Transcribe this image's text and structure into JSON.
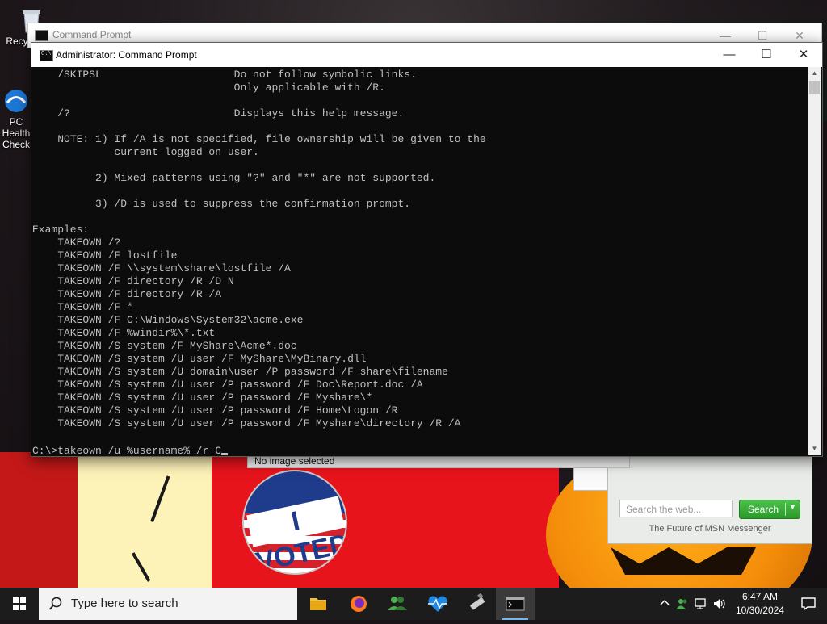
{
  "desktop": {
    "icons": [
      {
        "label": "Recycle Bin"
      },
      {
        "label": "PC Health Check"
      }
    ],
    "pin_text": "I VOTED",
    "msn_widget": {
      "search_placeholder": "Search the web...",
      "search_button": "Search",
      "tagline": "The Future of MSN Messenger"
    },
    "no_image_text": "No image selected"
  },
  "window_back": {
    "title": "Command Prompt",
    "controls": {
      "minimize": "—",
      "maximize": "☐",
      "close": "✕"
    }
  },
  "window": {
    "title": "Administrator: Command Prompt",
    "controls": {
      "minimize": "—",
      "maximize": "☐",
      "close": "✕"
    },
    "console_lines": [
      "    /SKIPSL                     Do not follow symbolic links.",
      "                                Only applicable with /R.",
      "",
      "    /?                          Displays this help message.",
      "",
      "    NOTE: 1) If /A is not specified, file ownership will be given to the",
      "             current logged on user.",
      "",
      "          2) Mixed patterns using \"?\" and \"*\" are not supported.",
      "",
      "          3) /D is used to suppress the confirmation prompt.",
      "",
      "Examples:",
      "    TAKEOWN /?",
      "    TAKEOWN /F lostfile",
      "    TAKEOWN /F \\\\system\\share\\lostfile /A",
      "    TAKEOWN /F directory /R /D N",
      "    TAKEOWN /F directory /R /A",
      "    TAKEOWN /F *",
      "    TAKEOWN /F C:\\Windows\\System32\\acme.exe",
      "    TAKEOWN /F %windir%\\*.txt",
      "    TAKEOWN /S system /F MyShare\\Acme*.doc",
      "    TAKEOWN /S system /U user /F MyShare\\MyBinary.dll",
      "    TAKEOWN /S system /U domain\\user /P password /F share\\filename",
      "    TAKEOWN /S system /U user /P password /F Doc\\Report.doc /A",
      "    TAKEOWN /S system /U user /P password /F Myshare\\*",
      "    TAKEOWN /S system /U user /P password /F Home\\Logon /R",
      "    TAKEOWN /S system /U user /P password /F Myshare\\directory /R /A",
      ""
    ],
    "prompt_line": "C:\\>takeown /u %username% /r C"
  },
  "taskbar": {
    "search_placeholder": "Type here to search",
    "apps": [
      {
        "name": "file-explorer"
      },
      {
        "name": "firefox"
      },
      {
        "name": "people"
      },
      {
        "name": "health-monitor"
      },
      {
        "name": "usb-drive"
      },
      {
        "name": "command-prompt",
        "active": true
      }
    ],
    "time": "6:47 AM",
    "date": "10/30/2024"
  },
  "colors": {
    "console_bg": "#0c0c0c",
    "console_fg": "#c0c0c0",
    "taskbar_bg": "#1c1c1c",
    "accent": "#76b9ed",
    "msn_green": "#2a9a2a"
  }
}
